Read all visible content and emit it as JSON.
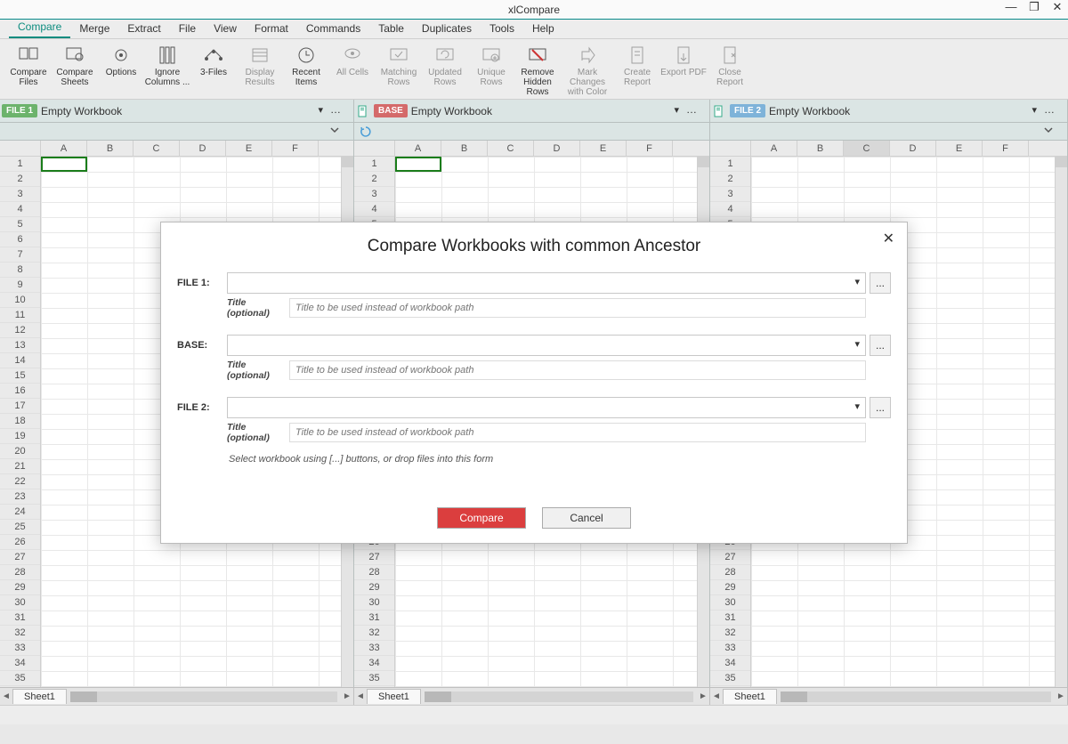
{
  "app": {
    "title": "xlCompare"
  },
  "window_controls": {
    "min": "—",
    "max": "❐",
    "close": "✕"
  },
  "menu": {
    "tabs": [
      "Compare",
      "Merge",
      "Extract",
      "File",
      "View",
      "Format",
      "Commands",
      "Table",
      "Duplicates",
      "Tools",
      "Help"
    ],
    "active": 0
  },
  "ribbon": [
    {
      "id": "compare-files",
      "label": "Compare Files"
    },
    {
      "id": "compare-sheets",
      "label": "Compare Sheets"
    },
    {
      "id": "options",
      "label": "Options"
    },
    {
      "id": "ignore-columns",
      "label": "Ignore Columns ..."
    },
    {
      "id": "three-files",
      "label": "3-Files"
    },
    {
      "id": "display-results",
      "label": "Display Results"
    },
    {
      "id": "recent-items",
      "label": "Recent Items"
    },
    {
      "id": "all-cells",
      "label": "All Cells"
    },
    {
      "id": "matching-rows",
      "label": "Matching Rows"
    },
    {
      "id": "updated-rows",
      "label": "Updated Rows"
    },
    {
      "id": "unique-rows",
      "label": "Unique Rows"
    },
    {
      "id": "remove-hidden",
      "label": "Remove Hidden Rows"
    },
    {
      "id": "mark-changes",
      "label": "Mark Changes with Color"
    },
    {
      "id": "create-report",
      "label": "Create Report"
    },
    {
      "id": "export-pdf",
      "label": "Export PDF"
    },
    {
      "id": "close-report",
      "label": "Close Report"
    }
  ],
  "panes": [
    {
      "badge": "FILE 1",
      "title": "Empty Workbook",
      "badgeClass": "f1"
    },
    {
      "badge": "BASE",
      "title": "Empty Workbook",
      "badgeClass": "fbase"
    },
    {
      "badge": "FILE 2",
      "title": "Empty Workbook",
      "badgeClass": "f2"
    }
  ],
  "grid": {
    "cols": [
      "A",
      "B",
      "C",
      "D",
      "E",
      "F"
    ],
    "p3_selected_col_index": 2,
    "rows_start": 1,
    "rows_end_visible": 35,
    "sheet_tab": "Sheet1"
  },
  "modal": {
    "title": "Compare Workbooks with common Ancestor",
    "fields": [
      {
        "label": "FILE 1:",
        "group": "file1"
      },
      {
        "label": "BASE:",
        "group": "base"
      },
      {
        "label": "FILE 2:",
        "group": "file2"
      }
    ],
    "title_label": "Title (optional)",
    "title_placeholder": "Title to be used instead of workbook path",
    "hint": "Select workbook using [...] buttons, or drop files into this form",
    "compare_btn": "Compare",
    "cancel_btn": "Cancel",
    "browse": "..."
  }
}
